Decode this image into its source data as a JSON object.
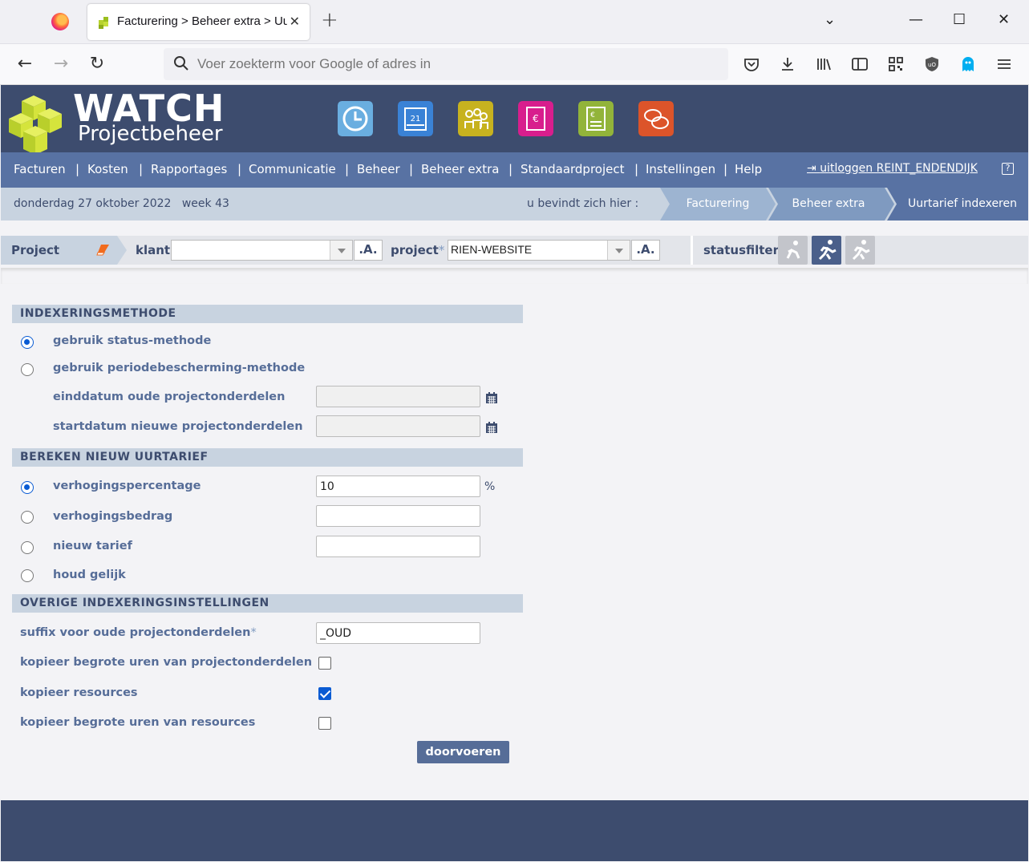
{
  "browser": {
    "tab_title": "Facturering > Beheer extra > Uurtarief indexeren",
    "tab_close": "✕",
    "new_tab": "+",
    "url_placeholder": "Voer zoekterm voor Google of adres in",
    "window_controls": {
      "list": "⌄",
      "minimize": "—",
      "maximize": "☐",
      "close": "✕"
    },
    "nav": {
      "back": "←",
      "forward": "→",
      "reload": "↻"
    }
  },
  "header": {
    "logo_title": "WATCH",
    "logo_subtitle": "Projectbeheer",
    "app_icons": [
      "clock-app-icon",
      "calendar-app-icon",
      "people-app-icon",
      "invoice-app-icon",
      "calculator-app-icon",
      "chat-app-icon"
    ]
  },
  "menu": {
    "items": [
      "Facturen",
      "Kosten",
      "Rapportages",
      "Communicatie",
      "Beheer",
      "Beheer extra",
      "Standaardproject",
      "Instellingen",
      "Help"
    ],
    "separator": "|",
    "logout": "uitloggen REINT_ENDENDIJK",
    "help_symbol": "?"
  },
  "crumbs": {
    "date": "donderdag 27 oktober 2022",
    "week": "week 43",
    "here": "u bevindt zich hier :",
    "path": [
      "Facturering",
      "Beheer extra",
      "Uurtarief indexeren"
    ]
  },
  "project_bar": {
    "tab": "Project",
    "klant_label": "klant",
    "klant_value": "",
    "project_label": "project",
    "required_mark": "*",
    "project_value": "RIEN-WEBSITE",
    "a_button": ".A.",
    "statusfilter_label": "statusfilter"
  },
  "form": {
    "section1": "INDEXERINGSMETHODE",
    "status_method": "gebruik status-methode",
    "period_method": "gebruik periodebescherming-methode",
    "enddate_label": "einddatum oude projectonderdelen",
    "startdate_label": "startdatum nieuwe projectonderdelen",
    "enddate_value": "",
    "startdate_value": "",
    "section2": "BEREKEN NIEUW UURTARIEF",
    "pct_label": "verhogingspercentage",
    "pct_value": "10",
    "pct_unit": "%",
    "amount_label": "verhogingsbedrag",
    "amount_value": "",
    "new_rate_label": "nieuw tarief",
    "new_rate_value": "",
    "keep_label": "houd gelijk",
    "section3": "OVERIGE INDEXERINGSINSTELLINGEN",
    "suffix_label": "suffix voor oude projectonderdelen",
    "suffix_required": "*",
    "suffix_value": "_OUD",
    "copy_hours_parts_label": "kopieer begrote uren van projectonderdelen",
    "copy_resources_label": "kopieer resources",
    "copy_hours_resources_label": "kopieer begrote uren van resources",
    "submit": "doorvoeren"
  },
  "colors": {
    "header": "#3d4c6e",
    "menu": "#5872a3",
    "crumb_bar": "#c8d3e0",
    "accent_blue": "#0a5bd3"
  }
}
